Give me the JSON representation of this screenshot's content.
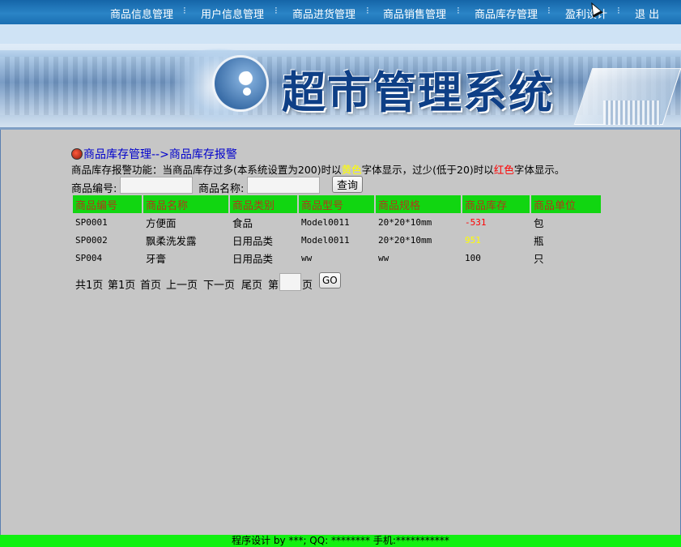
{
  "nav": {
    "items": [
      "商品信息管理",
      "用户信息管理",
      "商品进货管理",
      "商品销售管理",
      "商品库存管理",
      "盈利设计",
      "退 出"
    ],
    "separator": "⁝"
  },
  "banner": {
    "title": "超市管理系统"
  },
  "breadcrumb": {
    "text": "商品库存管理-->商品库存报警"
  },
  "description": {
    "part1": "商品库存报警功能：当商品库存过多(本系统设置为200)时以",
    "yellow_word": "黄色",
    "part2": "字体显示，过少(低于20)时以",
    "red_word": "红色",
    "part3": "字体显示。"
  },
  "search": {
    "code_label": "商品编号:",
    "code_value": "",
    "name_label": "商品名称:",
    "name_value": "",
    "query_button": "查询"
  },
  "table": {
    "headers": [
      "商品编号",
      "商品名称",
      "商品类别",
      "商品型号",
      "商品规格",
      "商品库存",
      "商品单位"
    ],
    "rows": [
      {
        "code": "SP0001",
        "name": "方便面",
        "category": "食品",
        "model": "Model0011",
        "spec": "20*20*10mm",
        "stock": "-531",
        "unit": "包"
      },
      {
        "code": "SP0002",
        "name": "飘柔洗发露",
        "category": "日用品类",
        "model": "Model0011",
        "spec": "20*20*10mm",
        "stock": "951",
        "unit": "瓶"
      },
      {
        "code": "SP004",
        "name": "牙膏",
        "category": "日用品类",
        "model": "ww",
        "spec": "ww",
        "stock": "100",
        "unit": "只"
      }
    ]
  },
  "pager": {
    "total": "共1页",
    "current": "第1页",
    "first": "首页",
    "prev": "上一页",
    "next": "下一页",
    "last": "尾页",
    "goto_prefix": "第",
    "goto_value": "",
    "goto_suffix": "页",
    "go_button": "GO"
  },
  "footer": {
    "text": "程序设计 by ***; QQ: ******** 手机:***********"
  },
  "colors": {
    "header_green": "#11d611",
    "warn_yellow": "#ffff00",
    "warn_red": "#ff0000",
    "footer_green": "#11f011"
  }
}
